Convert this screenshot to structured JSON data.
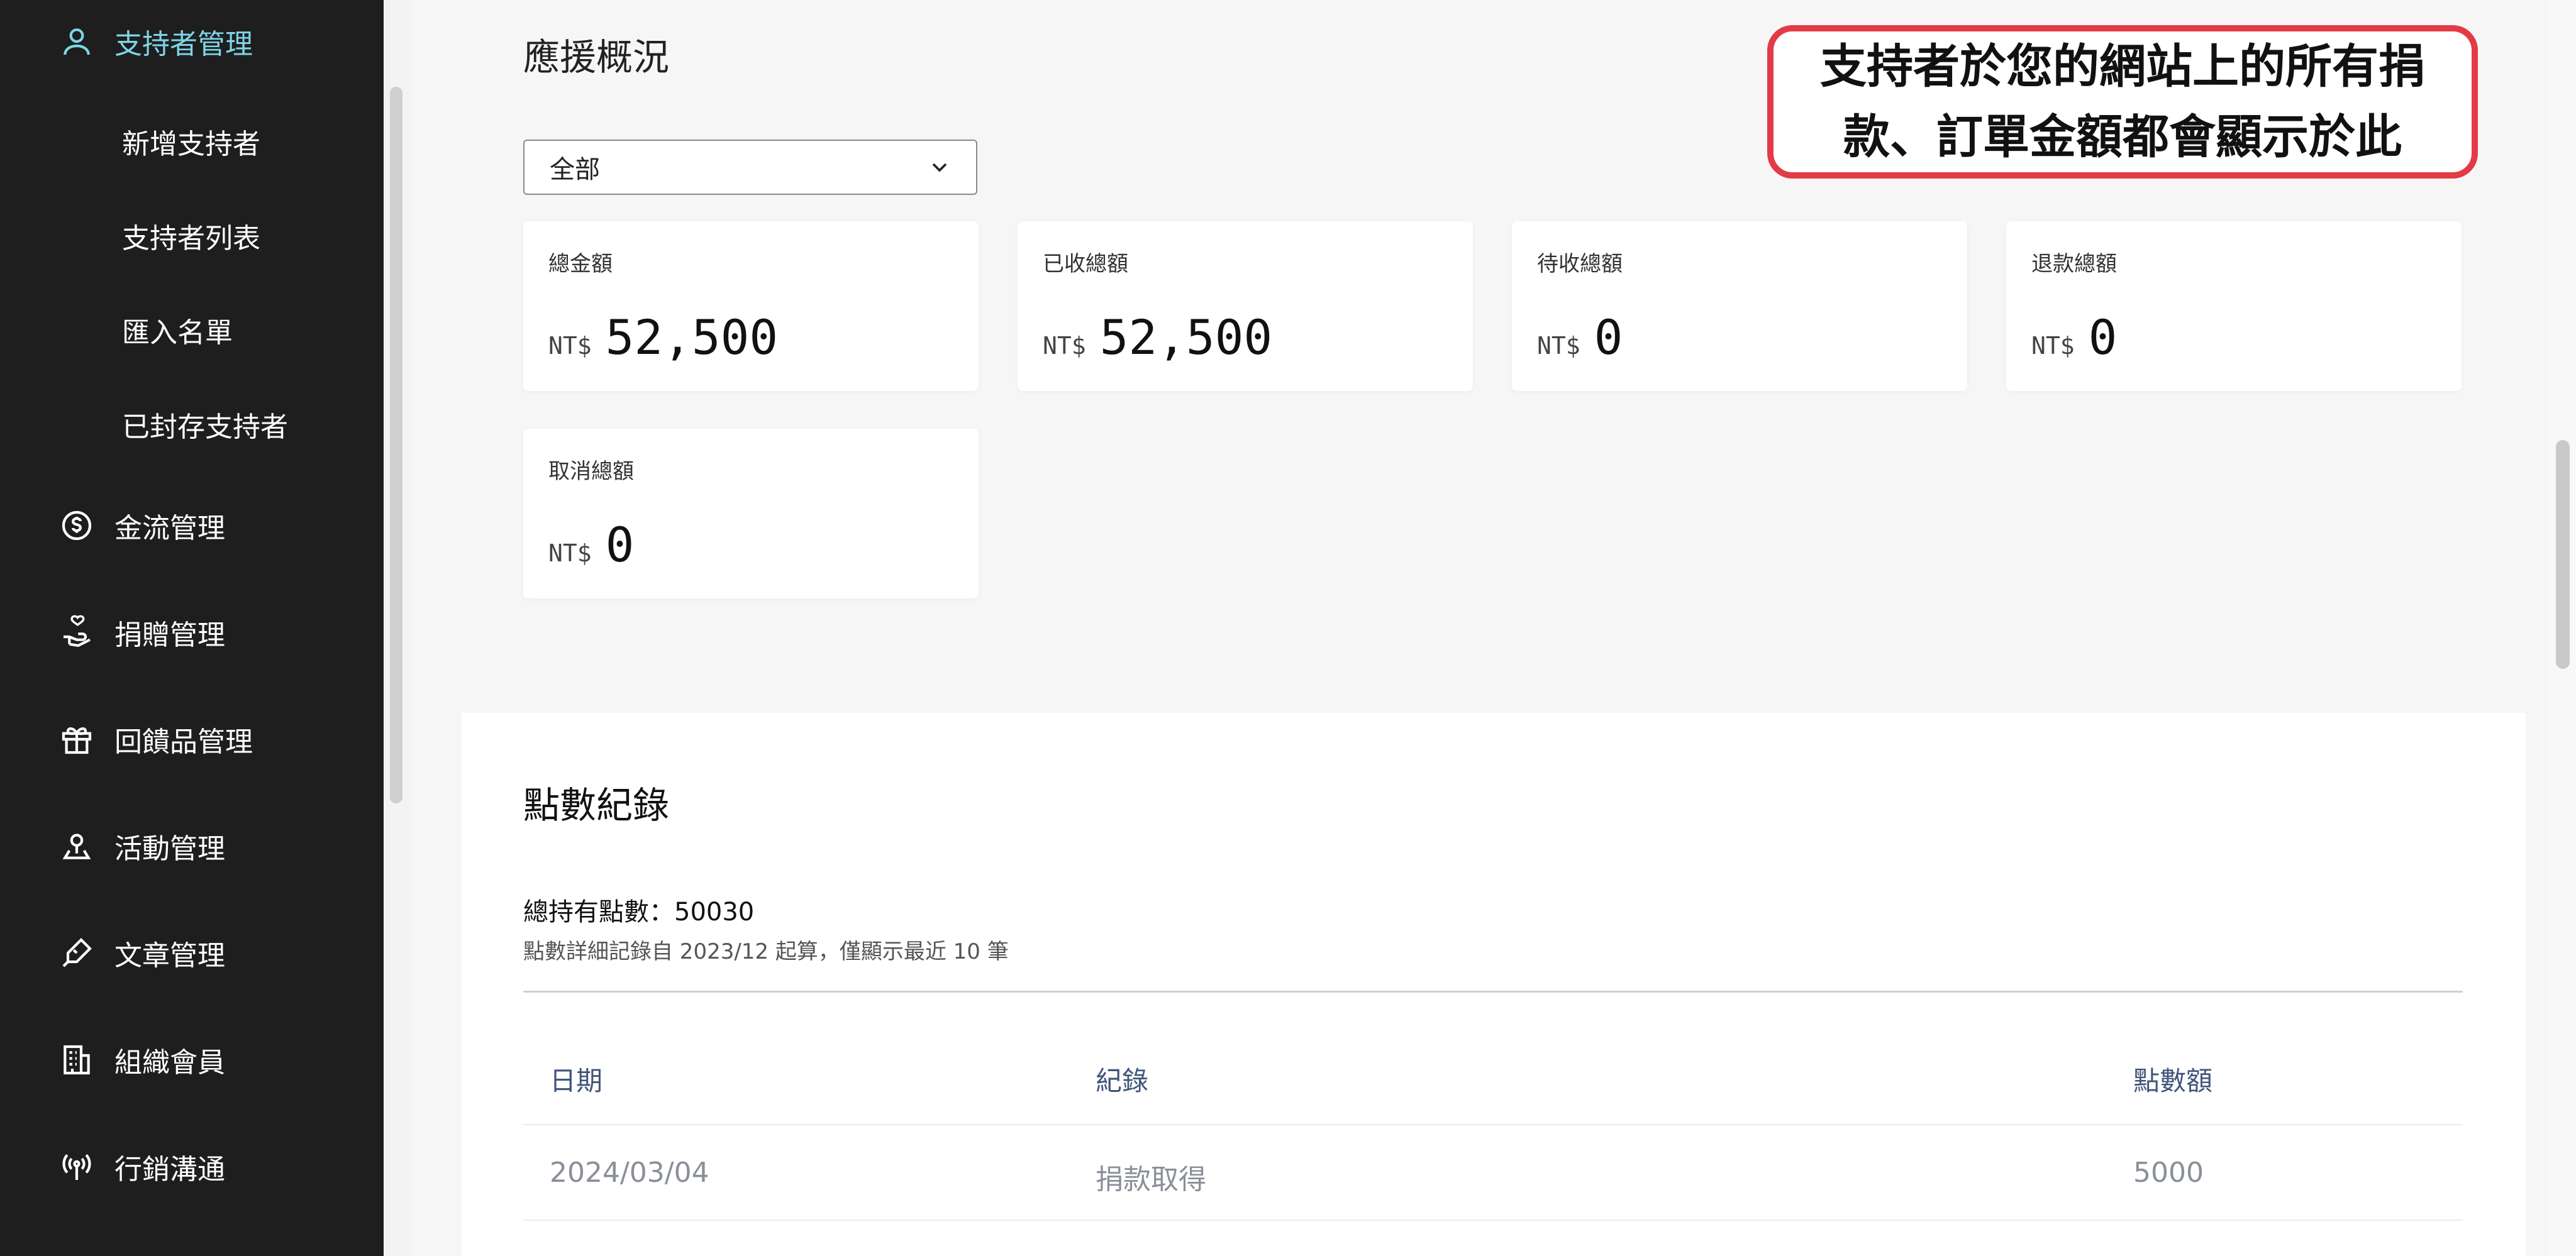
{
  "sidebar": {
    "active_item": "支持者管理",
    "sub_items": [
      "新增支持者",
      "支持者列表",
      "匯入名單",
      "已封存支持者"
    ],
    "items": [
      "金流管理",
      "捐贈管理",
      "回饋品管理",
      "活動管理",
      "文章管理",
      "組織會員",
      "行銷溝通"
    ]
  },
  "overview": {
    "title": "應援概況",
    "filter_value": "全部",
    "cards": [
      {
        "label": "總金額",
        "currency": "NT$",
        "value": "52,500"
      },
      {
        "label": "已收總額",
        "currency": "NT$",
        "value": "52,500"
      },
      {
        "label": "待收總額",
        "currency": "NT$",
        "value": "0"
      },
      {
        "label": "退款總額",
        "currency": "NT$",
        "value": "0"
      },
      {
        "label": "取消總額",
        "currency": "NT$",
        "value": "0"
      }
    ]
  },
  "callout": {
    "line1": "支持者於您的網站上的所有捐",
    "line2": "款、訂單金額都會顯示於此",
    "border_color": "#e23b45"
  },
  "points": {
    "title": "點數紀錄",
    "total": "總持有點數：50030",
    "note": "點數詳細記錄自 2023/12 起算，僅顯示最近 10 筆",
    "columns": [
      "日期",
      "紀錄",
      "點數額"
    ],
    "rows": [
      {
        "date": "2024/03/04",
        "record": "捐款取得",
        "amount": "5000"
      }
    ]
  },
  "colors": {
    "sidebar_bg": "#1e1e1e",
    "active": "#7dd6e8",
    "background": "#f6f6f6"
  }
}
